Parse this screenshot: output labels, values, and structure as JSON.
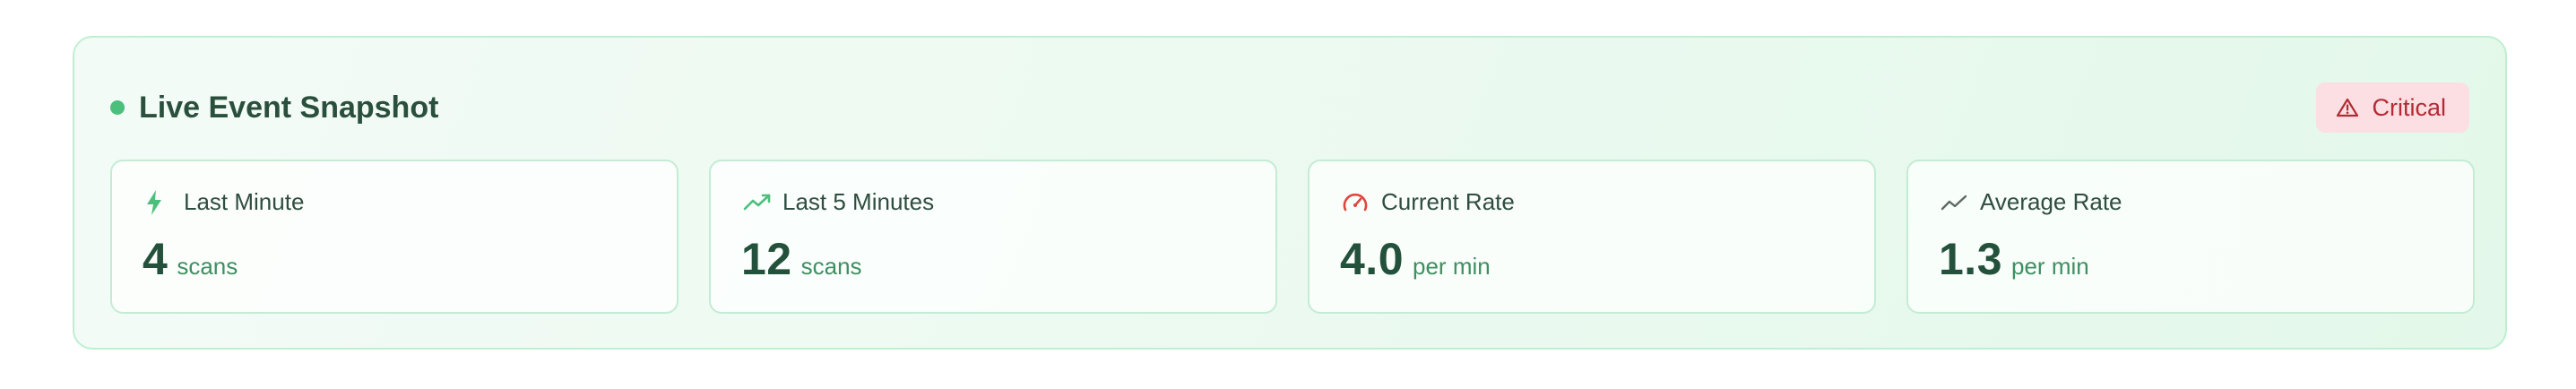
{
  "header": {
    "title": "Live Event Snapshot",
    "badge_label": "Critical"
  },
  "cards": [
    {
      "label": "Last Minute",
      "value": "4",
      "unit": "scans",
      "icon": "lightning-bolt-icon"
    },
    {
      "label": "Last 5 Minutes",
      "value": "12",
      "unit": "scans",
      "icon": "trending-up-icon"
    },
    {
      "label": "Current Rate",
      "value": "4.0",
      "unit": "per min",
      "icon": "speedometer-icon"
    },
    {
      "label": "Average Rate",
      "value": "1.3",
      "unit": "per min",
      "icon": "trend-line-icon"
    }
  ],
  "colors": {
    "accent": "#4cbf7d",
    "critical": "#b42a34",
    "critical_bg": "#fbdfe2",
    "gauge": "#e0463e"
  }
}
